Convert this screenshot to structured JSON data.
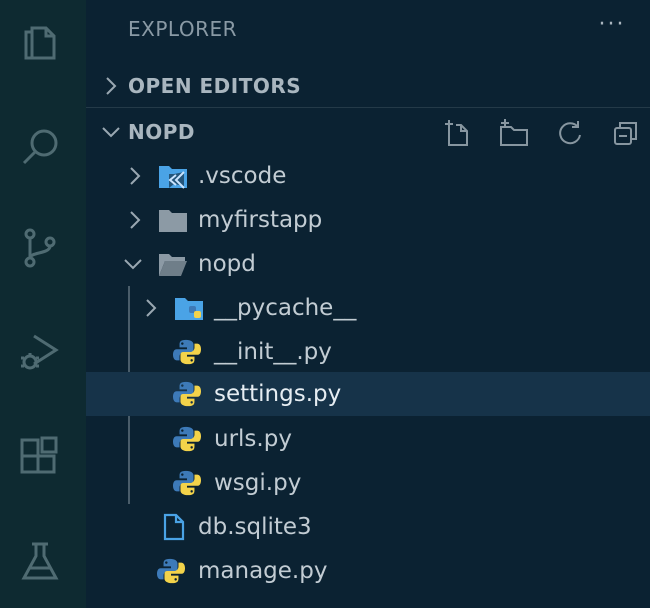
{
  "explorer": {
    "title": "EXPLORER",
    "more_actions": "···"
  },
  "sections": {
    "open_editors": "OPEN EDITORS",
    "workspace": "NOPD"
  },
  "activity_bar": [
    "files-icon",
    "search-icon",
    "source-control-icon",
    "run-debug-icon",
    "extensions-icon",
    "testing-icon"
  ],
  "header_actions": [
    "new-file-icon",
    "new-folder-icon",
    "refresh-icon",
    "collapse-all-icon"
  ],
  "tree": {
    "vscode_folder": ".vscode",
    "myfirstapp_folder": "myfirstapp",
    "nopd_folder": "nopd",
    "pycache_folder": "__pycache__",
    "init_file": "__init__.py",
    "settings_file": "settings.py",
    "urls_file": "urls.py",
    "wsgi_file": "wsgi.py",
    "db_file": "db.sqlite3",
    "manage_file": "manage.py"
  },
  "selected_item": "settings.py",
  "colors": {
    "activity_bar_bg": "#0e2a31",
    "sidebar_bg": "#0b2232",
    "selection_bg": "#163349",
    "folder_blue": "#4aa3e6",
    "python_blue": "#3d7ab8",
    "python_yellow": "#f3d34a"
  }
}
